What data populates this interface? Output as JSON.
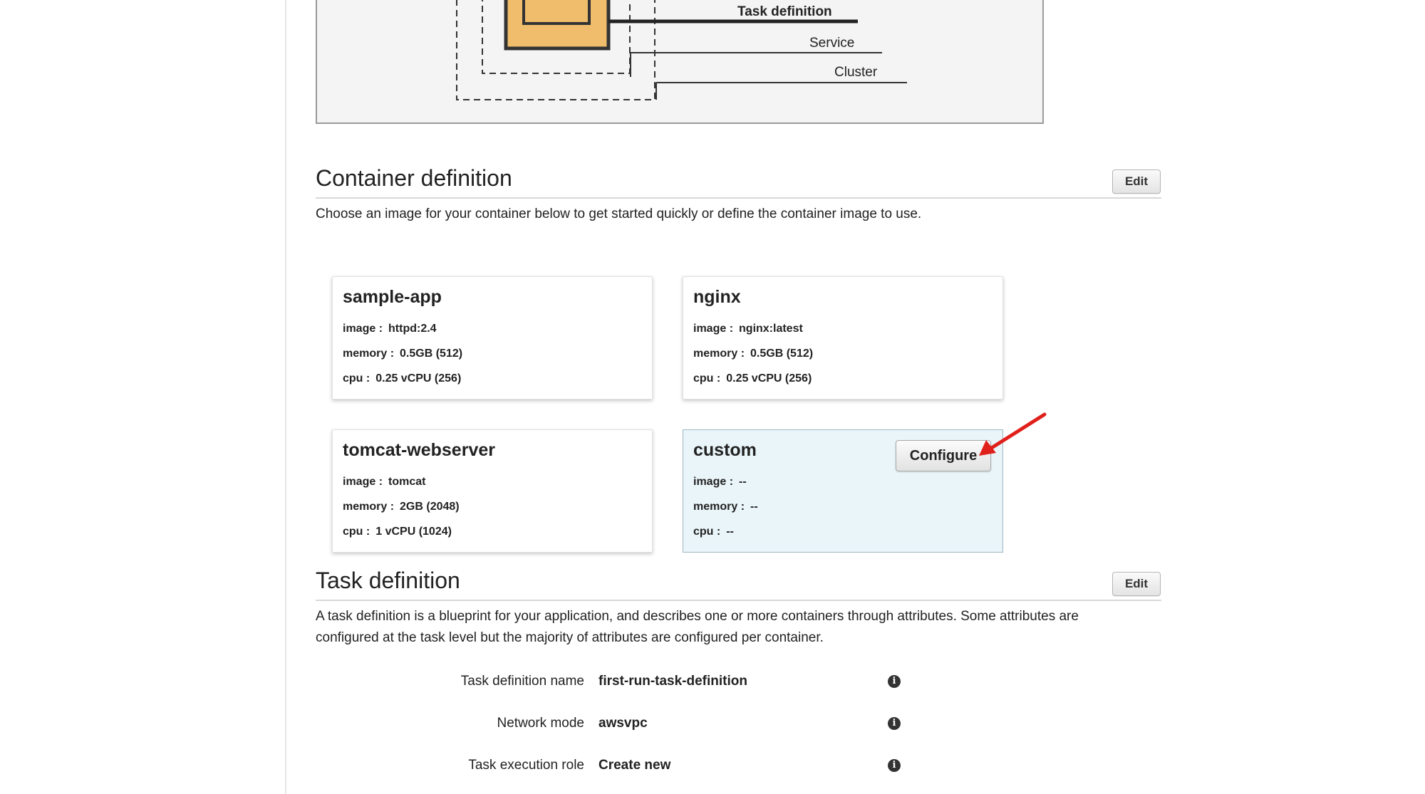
{
  "diagram": {
    "labels": {
      "task_definition": "Task definition",
      "service": "Service",
      "cluster": "Cluster"
    },
    "colors": {
      "container_fill": "#efbd6b",
      "background": "#f4f4f4"
    }
  },
  "container_definition": {
    "title": "Container definition",
    "edit_label": "Edit",
    "description": "Choose an image for your container below to get started quickly or define the container image to use.",
    "cards": [
      {
        "name": "sample-app",
        "image_label": "image :",
        "image_value": "httpd:2.4",
        "memory_label": "memory :",
        "memory_value": "0.5GB (512)",
        "cpu_label": "cpu :",
        "cpu_value": "0.25 vCPU (256)"
      },
      {
        "name": "nginx",
        "image_label": "image :",
        "image_value": "nginx:latest",
        "memory_label": "memory :",
        "memory_value": "0.5GB (512)",
        "cpu_label": "cpu :",
        "cpu_value": "0.25 vCPU (256)"
      },
      {
        "name": "tomcat-webserver",
        "image_label": "image :",
        "image_value": "tomcat",
        "memory_label": "memory :",
        "memory_value": "2GB (2048)",
        "cpu_label": "cpu :",
        "cpu_value": "1 vCPU (1024)"
      },
      {
        "name": "custom",
        "image_label": "image :",
        "image_value": "--",
        "memory_label": "memory :",
        "memory_value": "--",
        "cpu_label": "cpu :",
        "cpu_value": "--",
        "configure_label": "Configure",
        "selected": true
      }
    ]
  },
  "task_definition": {
    "title": "Task definition",
    "edit_label": "Edit",
    "description_line1": "A task definition is a blueprint for your application, and describes one or more containers through attributes. Some attributes are",
    "description_line2": "configured at the task level but the majority of attributes are configured per container.",
    "fields": [
      {
        "label": "Task definition name",
        "value": "first-run-task-definition",
        "icon": "info-icon"
      },
      {
        "label": "Network mode",
        "value": "awsvpc",
        "icon": "info-icon"
      },
      {
        "label": "Task execution role",
        "value": "Create new",
        "icon": "info-icon"
      }
    ]
  },
  "annotation": {
    "arrow_color": "#e0201b",
    "arrow_icon": "red-arrow-icon"
  }
}
